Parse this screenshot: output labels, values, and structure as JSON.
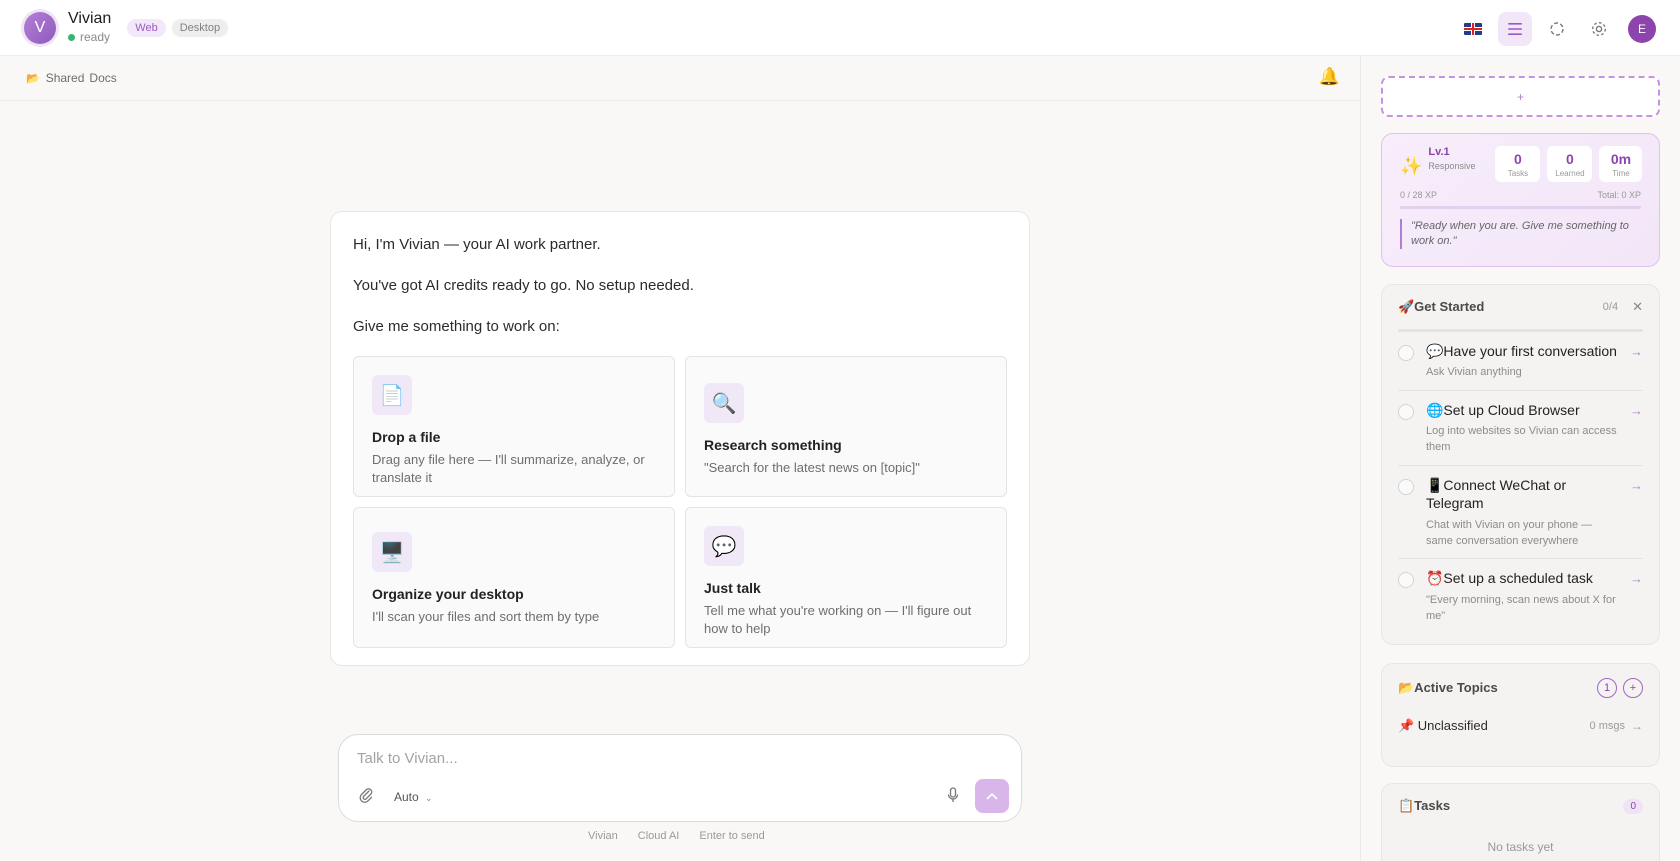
{
  "header": {
    "avatar_letter": "V",
    "name": "Vivian",
    "status": "ready",
    "chips": [
      "Web",
      "Desktop"
    ],
    "user_initial": "E"
  },
  "subbar": {
    "label_shared": "Shared",
    "label_docs": "Docs"
  },
  "welcome": {
    "line1": "Hi, I'm Vivian — your AI work partner.",
    "line2": "You've got AI credits ready to go. No setup needed.",
    "line3": "Give me something to work on:",
    "tiles": [
      {
        "icon": "📄",
        "title": "Drop a file",
        "desc": "Drag any file here — I'll summarize, analyze, or translate it"
      },
      {
        "icon": "🔍",
        "title": "Research something",
        "desc": "\"Search for the latest news on [topic]\""
      },
      {
        "icon": "🖥️",
        "title": "Organize your desktop",
        "desc": "I'll scan your files and sort them by type"
      },
      {
        "icon": "💬",
        "title": "Just talk",
        "desc": "Tell me what you're working on — I'll figure out how to help"
      }
    ]
  },
  "composer": {
    "placeholder": "Talk to Vivian...",
    "model": "Auto"
  },
  "footer": [
    "Vivian",
    "Cloud AI",
    "Enter to send"
  ],
  "right": {
    "add_label": "+",
    "level": {
      "label": "Lv.1",
      "sub": "Responsive",
      "stats": [
        {
          "value": "0",
          "label": "Tasks"
        },
        {
          "value": "0",
          "label": "Learned"
        },
        {
          "value": "0m",
          "label": "Time"
        }
      ],
      "xp": "0 / 28 XP",
      "total": "Total: 0 XP",
      "xp_fraction": 0,
      "quote": "\"Ready when you are. Give me something to work on.\""
    },
    "get_started": {
      "title": "🚀Get Started",
      "count": "0/4",
      "items": [
        {
          "title": "💬Have your first conversation",
          "desc": "Ask Vivian anything"
        },
        {
          "title": "🌐Set up Cloud Browser",
          "desc": "Log into websites so Vivian can access them"
        },
        {
          "title": "📱Connect WeChat or Telegram",
          "desc": "Chat with Vivian on your phone — same conversation everywhere"
        },
        {
          "title": "⏰Set up a scheduled task",
          "desc": "\"Every morning, scan news about X for me\""
        }
      ]
    },
    "active_topics": {
      "title": "📂Active Topics",
      "count": "1",
      "topic_name": "📌 Unclassified",
      "topic_meta": "0 msgs"
    },
    "tasks": {
      "title": "📋Tasks",
      "count": "0",
      "empty": "No tasks yet"
    }
  }
}
